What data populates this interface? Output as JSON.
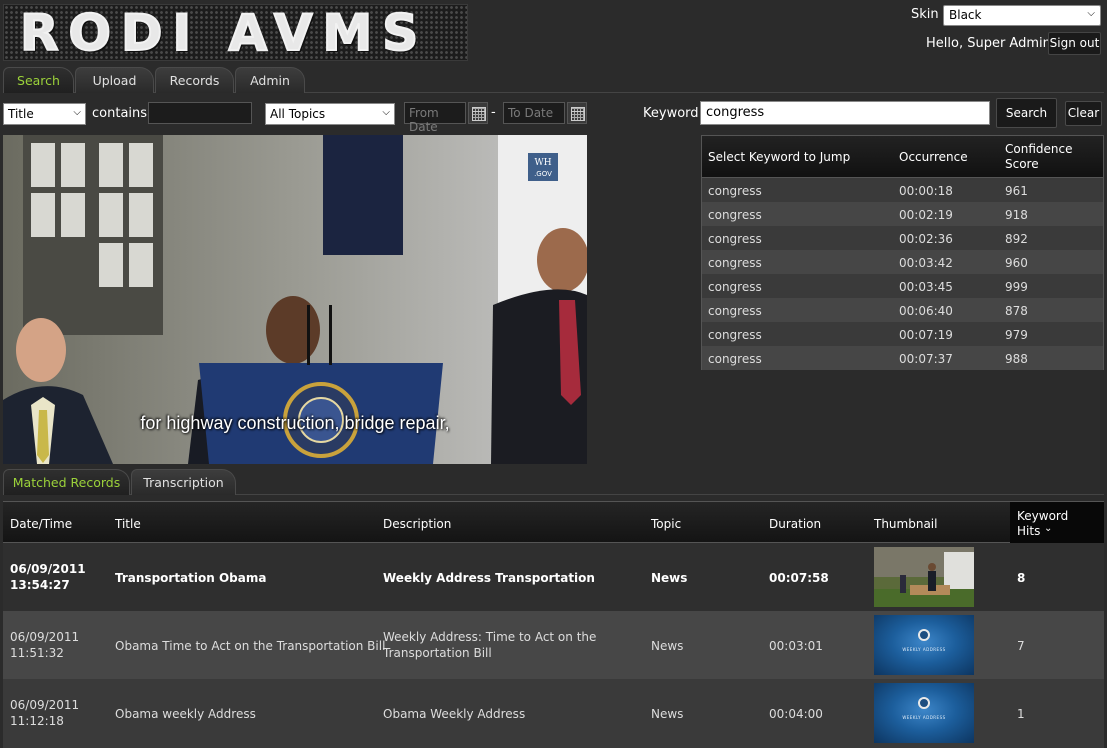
{
  "logo": {
    "text": "RODI AVMS"
  },
  "header": {
    "skin_label": "Skin",
    "skin_value": "Black",
    "greeting": "Hello, Super Admin",
    "signout_label": "Sign out"
  },
  "main_tabs": [
    {
      "label": "Search",
      "active": true
    },
    {
      "label": "Upload",
      "active": false
    },
    {
      "label": "Records",
      "active": false
    },
    {
      "label": "Admin",
      "active": false
    }
  ],
  "filters": {
    "field_value": "Title",
    "contains_label": "contains",
    "contains_value": "",
    "topic_value": "All Topics",
    "from_date_placeholder": "From Date",
    "date_separator": "-",
    "to_date_placeholder": "To Date"
  },
  "keyword_search": {
    "label": "Keyword",
    "value": "congress",
    "search_label": "Search",
    "clear_label": "Clear"
  },
  "video": {
    "caption": "for highway construction, bridge repair,",
    "watermark": "WH .GOV"
  },
  "keyword_grid": {
    "headers": {
      "keyword": "Select Keyword to Jump",
      "occurrence": "Occurrence",
      "score_line1": "Confidence",
      "score_line2": "Score"
    },
    "rows": [
      {
        "keyword": "congress",
        "occurrence": "00:00:18",
        "score": "961"
      },
      {
        "keyword": "congress",
        "occurrence": "00:02:19",
        "score": "918"
      },
      {
        "keyword": "congress",
        "occurrence": "00:02:36",
        "score": "892"
      },
      {
        "keyword": "congress",
        "occurrence": "00:03:42",
        "score": "960"
      },
      {
        "keyword": "congress",
        "occurrence": "00:03:45",
        "score": "999"
      },
      {
        "keyword": "congress",
        "occurrence": "00:06:40",
        "score": "878"
      },
      {
        "keyword": "congress",
        "occurrence": "00:07:19",
        "score": "979"
      },
      {
        "keyword": "congress",
        "occurrence": "00:07:37",
        "score": "988"
      }
    ]
  },
  "result_tabs": [
    {
      "label": "Matched Records",
      "active": true
    },
    {
      "label": "Transcription",
      "active": false
    }
  ],
  "records": {
    "headers": {
      "datetime": "Date/Time",
      "title": "Title",
      "description": "Description",
      "topic": "Topic",
      "duration": "Duration",
      "thumbnail": "Thumbnail",
      "hits_line1": "Keyword",
      "hits_line2": "Hits",
      "sort_icon": "chevron-down-icon"
    },
    "rows": [
      {
        "date": "06/09/2011",
        "time": "13:54:27",
        "title": "Transportation Obama",
        "description_line1": "Weekly Address Transportation",
        "description_line2": "",
        "topic": "News",
        "duration": "00:07:58",
        "hits": "8"
      },
      {
        "date": "06/09/2011",
        "time": "11:51:32",
        "title": "Obama Time to Act on the Transportation Bill",
        "description_line1": "Weekly Address: Time to Act on the",
        "description_line2": "Transportation Bill",
        "topic": "News",
        "duration": "00:03:01",
        "hits": "7"
      },
      {
        "date": "06/09/2011",
        "time": "11:12:18",
        "title": "Obama weekly Address",
        "description_line1": "Obama Weekly Address",
        "description_line2": "",
        "topic": "News",
        "duration": "00:04:00",
        "hits": "1"
      }
    ],
    "thumb_text": "WEEKLY ADDRESS"
  }
}
